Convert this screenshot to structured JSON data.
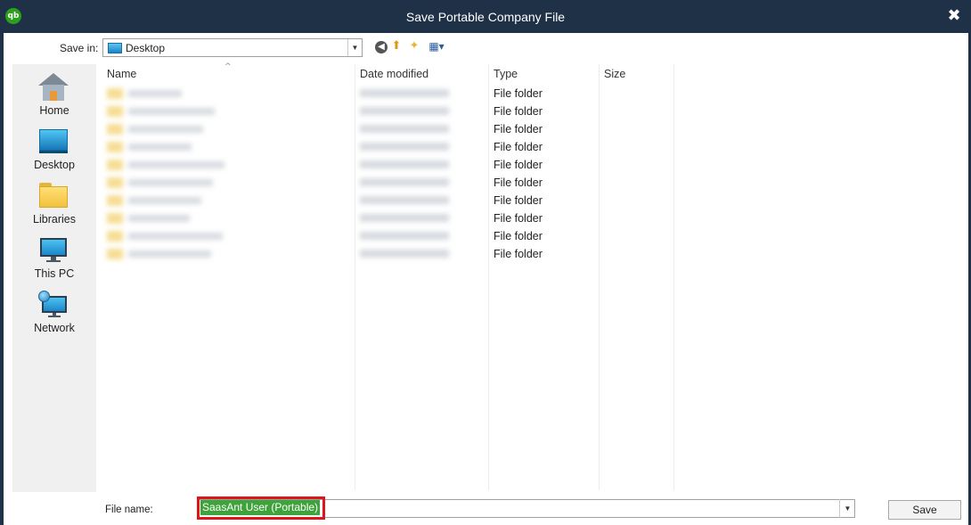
{
  "window": {
    "title": "Save Portable Company File",
    "app_icon_text": "qb",
    "close_glyph": "✖"
  },
  "toolbar": {
    "save_in_label": "Save in:",
    "save_in_value": "Desktop",
    "dropdown_glyph": "▼",
    "back_glyph": "◀",
    "up_glyph": "⬆",
    "new_folder_glyph": "✦",
    "views_glyph": "▦▾"
  },
  "places": [
    {
      "label": "Home",
      "icon": "home-icon"
    },
    {
      "label": "Desktop",
      "icon": "desktop-icon"
    },
    {
      "label": "Libraries",
      "icon": "libraries-icon"
    },
    {
      "label": "This PC",
      "icon": "this-pc-icon"
    },
    {
      "label": "Network",
      "icon": "network-icon"
    }
  ],
  "file_list": {
    "columns": {
      "name": "Name",
      "date_modified": "Date modified",
      "type": "Type",
      "size": "Size"
    },
    "sort_indicator": "^",
    "rows": [
      {
        "type": "File folder"
      },
      {
        "type": "File folder"
      },
      {
        "type": "File folder"
      },
      {
        "type": "File folder"
      },
      {
        "type": "File folder"
      },
      {
        "type": "File folder"
      },
      {
        "type": "File folder"
      },
      {
        "type": "File folder"
      },
      {
        "type": "File folder"
      },
      {
        "type": "File folder"
      }
    ]
  },
  "file_name": {
    "label": "File name:",
    "value": "SaasAnt User (Portable)",
    "highlight_color": "#e0141b"
  },
  "buttons": {
    "save": "Save"
  },
  "colors": {
    "titlebar": "#1f3147",
    "selection": "#3ea33a",
    "places_bg": "#f0f0f0"
  }
}
